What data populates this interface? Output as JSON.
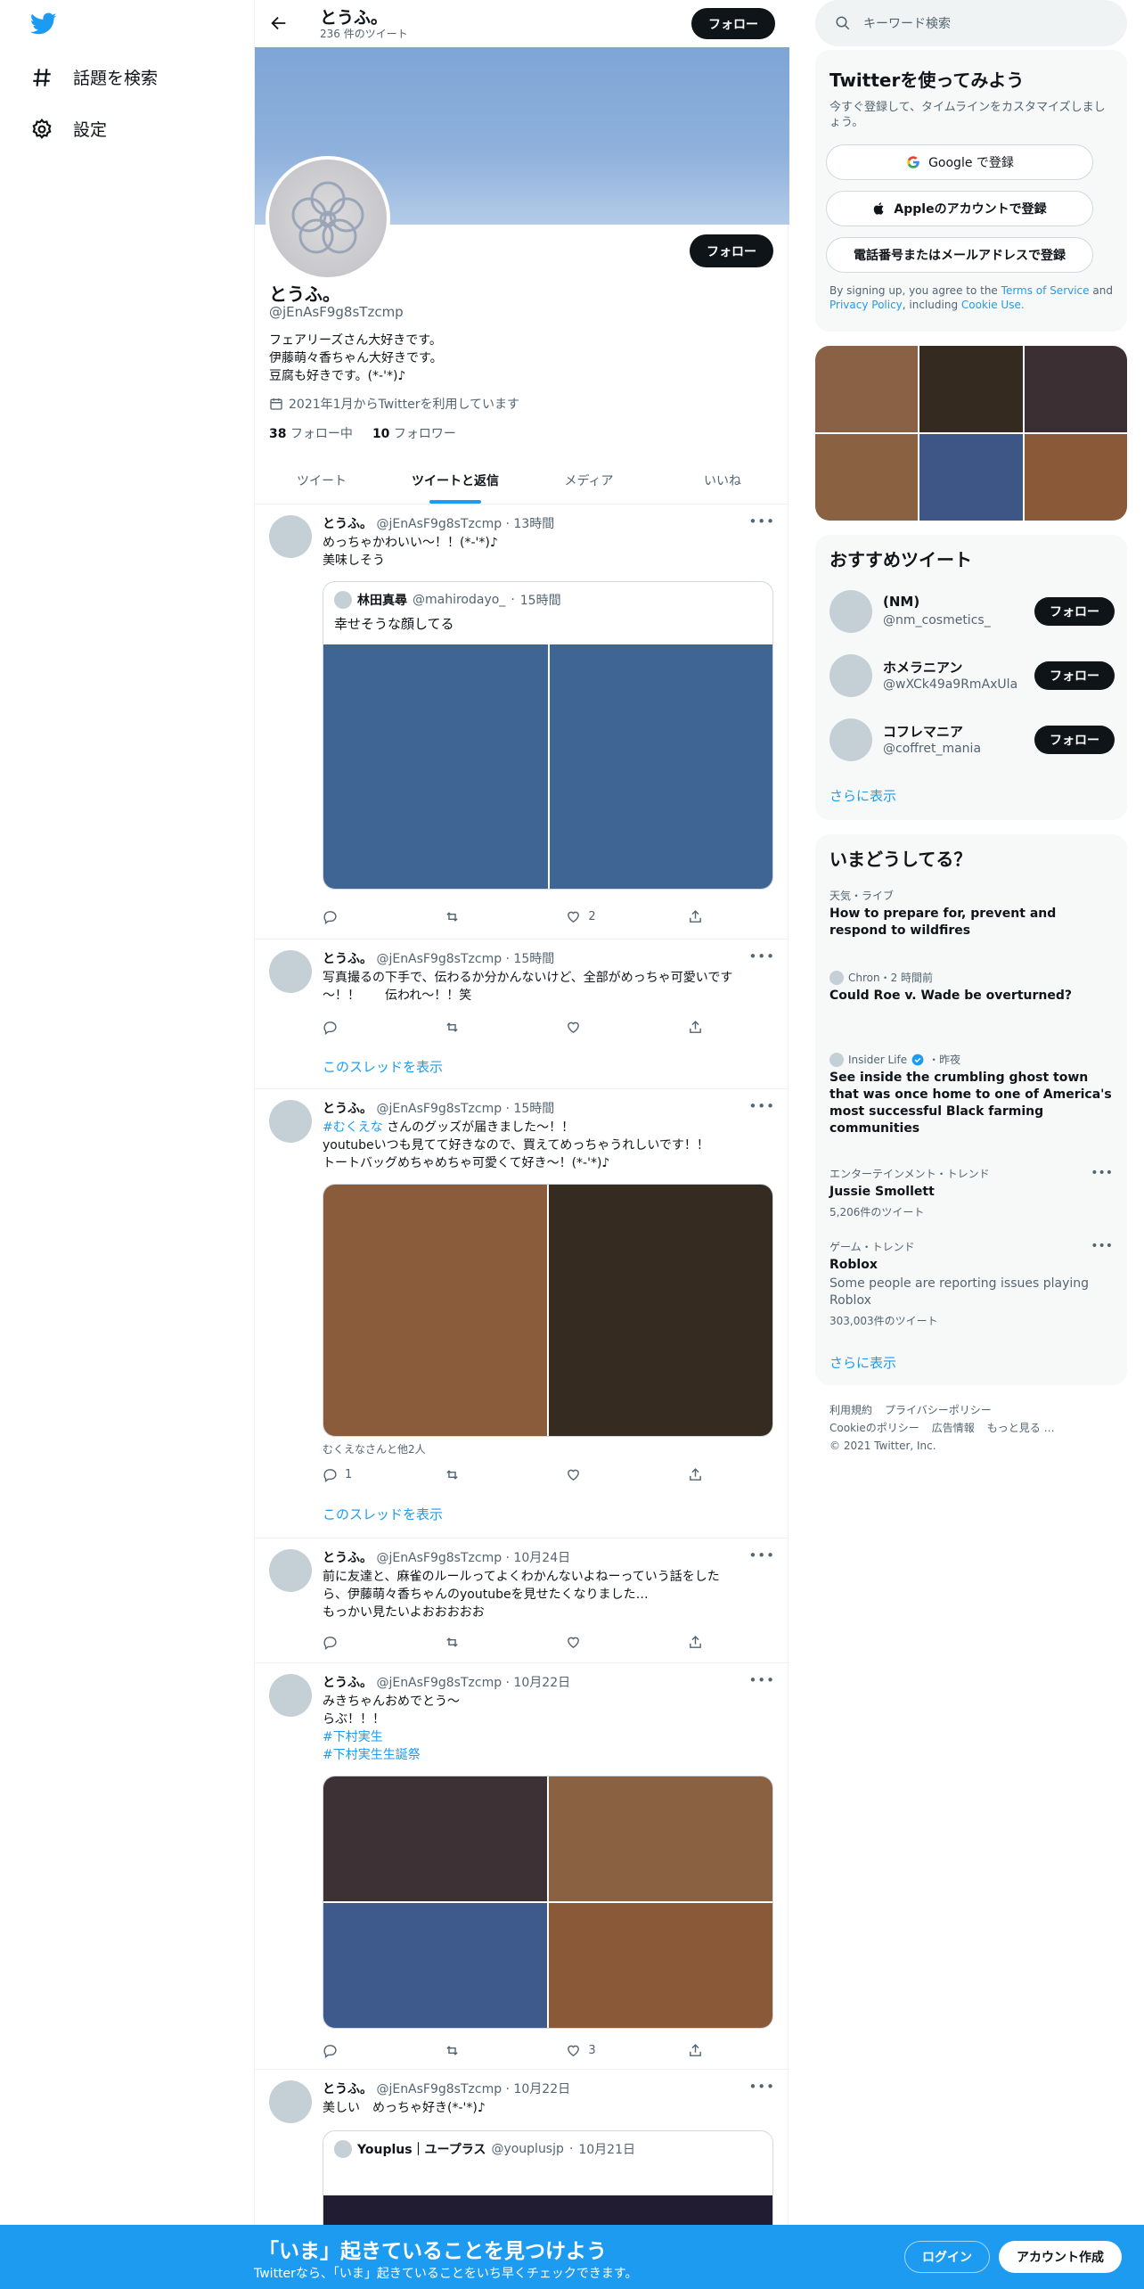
{
  "nav": {
    "explore_label": "話題を検索",
    "settings_label": "設定"
  },
  "profile": {
    "topbar_name": "とうふ。",
    "tweet_count": "236 件のツイート",
    "follow_label": "フォロー",
    "name": "とうふ。",
    "handle": "@jEnAsF9g8sTzcmp",
    "bio_lines": [
      "フェアリーズさん大好きです。",
      "伊藤萌々香ちゃん大好きです。",
      "豆腐も好きです。(*-'*)♪"
    ],
    "joined": "2021年1月からTwitterを利用しています",
    "following_count": "38",
    "following_label": "フォロー中",
    "followers_count": "10",
    "followers_label": "フォロワー",
    "banner_color": "#8fb1dc"
  },
  "tabs": [
    "ツイート",
    "ツイートと返信",
    "メディア",
    "いいね"
  ],
  "active_tab": "ツイートと返信",
  "tweets": [
    {
      "name": "とうふ。",
      "handle": "@jEnAsF9g8sTzcmp",
      "time": "13時間",
      "lines": [
        "めっちゃかわいい～！！(*-'*)♪",
        "美味しそう"
      ],
      "quote": {
        "name": "林田真尋",
        "handle": "@mahirodayo_",
        "time": "15時間",
        "text": "幸せそうな顔してる"
      },
      "media_colors": [
        "#3f6594",
        "#3f6594"
      ],
      "reply": "",
      "retweet": "",
      "like": "2"
    },
    {
      "name": "とうふ。",
      "handle": "@jEnAsF9g8sTzcmp",
      "time": "15時間",
      "lines": [
        "写真撮るの下手で、伝わるか分かんないけど、全部がめっちゃ可愛いです",
        "～！！　　伝われ～！！笑"
      ],
      "thread_label": "このスレッドを表示",
      "reply": "",
      "retweet": "",
      "like": ""
    },
    {
      "name": "とうふ。",
      "handle": "@jEnAsF9g8sTzcmp",
      "time": "15時間",
      "hashtag": "#むくえな",
      "lines": [
        "さんのグッズが届きました～！！",
        "youtubeいつも見てて好きなので、買えてめっちゃうれしいです！！",
        "トートバッグめちゃめちゃ可愛くて好き～！(*-'*)♪"
      ],
      "media_colors": [
        "#8a5c3c",
        "#362b21"
      ],
      "tagged": "むくえなさんと他2人",
      "thread_label": "このスレッドを表示",
      "reply": "1",
      "retweet": "",
      "like": ""
    },
    {
      "name": "とうふ。",
      "handle": "@jEnAsF9g8sTzcmp",
      "time": "10月24日",
      "lines": [
        "前に友達と、麻雀のルールってよくわかんないよねーっていう話をした",
        "ら、伊藤萌々香ちゃんのyoutubeを見せたくなりました…",
        "もっかい見たいよおおおおお"
      ],
      "reply": "",
      "retweet": "",
      "like": ""
    },
    {
      "name": "とうふ。",
      "handle": "@jEnAsF9g8sTzcmp",
      "time": "10月22日",
      "lines": [
        "みきちゃんおめでとう～",
        "らぶ！！！"
      ],
      "tags": [
        "#下村実生",
        "#下村実生生誕祭"
      ],
      "media_colors": [
        "#3d3136",
        "#8a6242",
        "#3e5a8c",
        "#8a5938"
      ],
      "reply": "",
      "retweet": "",
      "like": "3"
    },
    {
      "name": "とうふ。",
      "handle": "@jEnAsF9g8sTzcmp",
      "time": "10月22日",
      "lines": [
        "美しい　めっちゃ好き(*-'*)♪"
      ],
      "quote": {
        "name": "Youplus｜ユープラス",
        "handle": "@youplusjp",
        "time": "10月21日",
        "text": ""
      },
      "media_colors": [
        "#221c33"
      ]
    }
  ],
  "right": {
    "search_placeholder": "キーワード検索",
    "signup": {
      "title": "Twitterを使ってみよう",
      "sub": "今すぐ登録して、タイムラインをカスタマイズしましょう。",
      "google": "Google で登録",
      "apple": "Appleのアカウントで登録",
      "phone": "電話番号またはメールアドレスで登録",
      "terms_pre": "By signing up, you agree to the",
      "terms_tos": "Terms of Service",
      "terms_and": "and",
      "terms_privacy": "Privacy Policy",
      "terms_incl": ", including",
      "terms_cookie": "Cookie Use."
    },
    "media_colors": [
      "#8a6144",
      "#342a1f",
      "#3c2f33",
      "#8a6242",
      "#3e5686",
      "#8a5a38"
    ],
    "who": {
      "title": "おすすめツイート",
      "users": [
        {
          "name": "(NM)",
          "handle": "@nm_cosmetics_"
        },
        {
          "name": "ホメラニアン",
          "handle": "@wXCk49a9RmAxUla"
        },
        {
          "name": "コフレマニア",
          "handle": "@coffret_mania"
        }
      ],
      "follow_label": "フォロー",
      "more_label": "さらに表示"
    },
    "trends": {
      "title": "いまどうしてる？",
      "items": [
        {
          "meta": "天気・ライブ",
          "title": "How to prepare for, prevent and respond to wildfires"
        },
        {
          "meta": "Chron・2 時間前",
          "title": "Could Roe v. Wade be overturned?"
        },
        {
          "meta": "Insider Life",
          "meta_time": "・昨夜",
          "title": "See inside the crumbling ghost town that was once home to one of America's most successful Black farming communities"
        },
        {
          "meta": "エンターテインメント・トレンド",
          "title": "Jussie Smollett",
          "count": "5,206件のツイート"
        },
        {
          "meta": "ゲーム・トレンド",
          "title": "Roblox",
          "desc": "Some people are reporting issues playing Roblox",
          "count": "303,003件のツイート"
        }
      ],
      "more_label": "さらに表示"
    },
    "footer": {
      "links1": [
        "利用規約",
        "プライバシーポリシー"
      ],
      "links2": [
        "Cookieのポリシー",
        "広告情報",
        "もっと見る …"
      ],
      "copyright": "© 2021 Twitter, Inc."
    }
  },
  "bottom": {
    "title": "「いま」起きていることを見つけよう",
    "sub": "Twitterなら、「いま」起きていることをいち早くチェックできます。",
    "login": "ログイン",
    "signup": "アカウント作成"
  }
}
